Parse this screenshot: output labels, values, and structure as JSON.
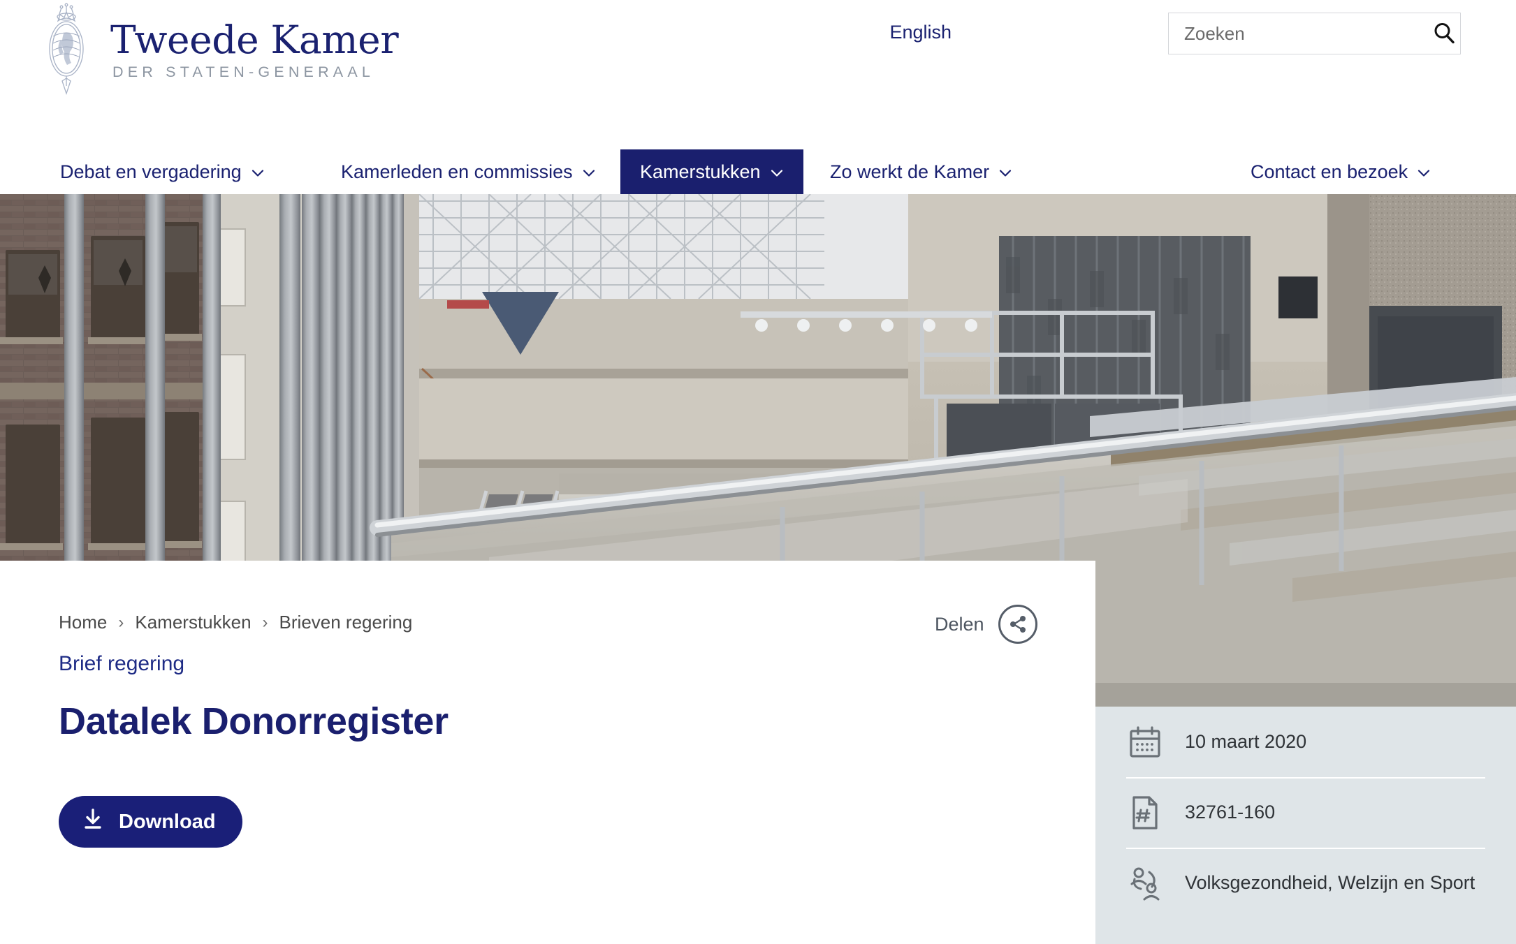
{
  "brand": {
    "title": "Tweede Kamer",
    "subtitle": "DER STATEN-GENERAAL",
    "crest_icon": "coat-of-arms-icon"
  },
  "header": {
    "language_link": "English",
    "search": {
      "placeholder": "Zoeken",
      "value": "",
      "icon": "search-icon"
    }
  },
  "nav": {
    "items": [
      {
        "label": "Debat en vergadering",
        "active": false,
        "icon": "chevron-down-icon"
      },
      {
        "label": "Kamerleden en commissies",
        "active": false,
        "icon": "chevron-down-icon"
      },
      {
        "label": "Kamerstukken",
        "active": true,
        "icon": "chevron-down-icon"
      },
      {
        "label": "Zo werkt de Kamer",
        "active": false,
        "icon": "chevron-down-icon"
      },
      {
        "label": "Contact en bezoek",
        "active": false,
        "icon": "chevron-down-icon"
      }
    ]
  },
  "hero": {
    "alt": "Interior atrium of the Dutch House of Representatives building"
  },
  "content": {
    "breadcrumb": [
      {
        "label": "Home"
      },
      {
        "label": "Kamerstukken"
      },
      {
        "label": "Brieven regering"
      }
    ],
    "breadcrumb_separator": "›",
    "kicker": "Brief regering",
    "title": "Datalek Donorregister",
    "share": {
      "label": "Delen",
      "icon": "share-icon"
    },
    "download": {
      "label": "Download",
      "icon": "download-icon"
    }
  },
  "meta": {
    "rows": [
      {
        "icon": "calendar-icon",
        "value": "10 maart 2020"
      },
      {
        "icon": "document-number-icon",
        "value": "32761-160"
      },
      {
        "icon": "people-group-icon",
        "value": "Volksgezondheid, Welzijn en Sport"
      }
    ]
  },
  "colors": {
    "brand_navy": "#1a1f6e",
    "link_navy": "#1e2b85",
    "meta_panel": "#dfe5e8",
    "subtitle_gray": "#8c95a1"
  }
}
